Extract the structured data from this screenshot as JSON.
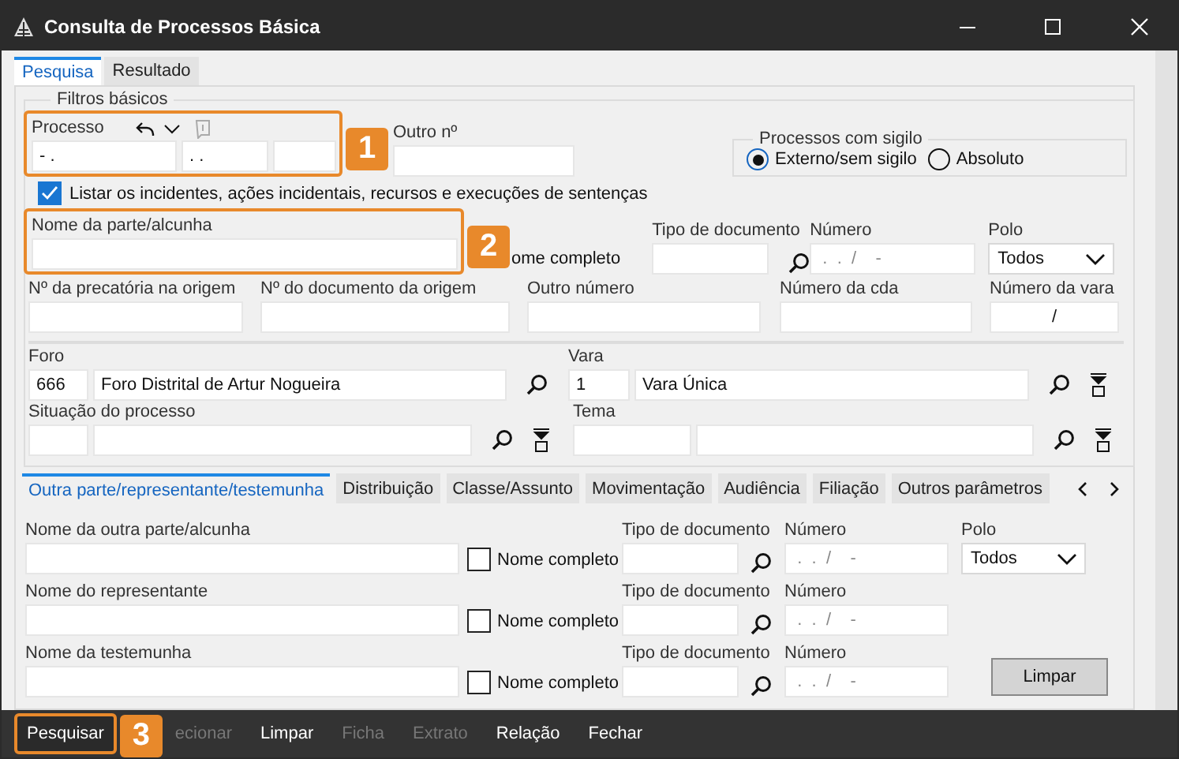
{
  "window": {
    "title": "Consulta de Processos Básica"
  },
  "tabs": [
    {
      "label": "Pesquisa",
      "selected": true
    },
    {
      "label": "Resultado",
      "selected": false
    }
  ],
  "filtros": {
    "legend": "Filtros básicos",
    "processo": {
      "label": "Processo",
      "values": [
        "- .",
        ". ."
      ]
    },
    "outro_no": {
      "label": "Outro nº"
    },
    "sigilo": {
      "legend": "Processos com sigilo",
      "options": [
        {
          "label": "Externo/sem sigilo",
          "selected": true
        },
        {
          "label": "Absoluto",
          "selected": false
        }
      ]
    },
    "listar": {
      "label": "Listar os incidentes, ações incidentais, recursos e execuções de sentenças",
      "checked": true
    },
    "nome_parte": {
      "label": "Nome da parte/alcunha",
      "nome_completo": "ome completo"
    },
    "tipo_documento": {
      "label": "Tipo de documento"
    },
    "numero": {
      "label": "Número",
      "placeholder": " .  .  /    -"
    },
    "polo": {
      "label": "Polo",
      "value": "Todos"
    },
    "outros_numeros": [
      {
        "label": "Nº da precatória na origem"
      },
      {
        "label": "Nº do documento da origem"
      },
      {
        "label": "Outro número"
      },
      {
        "label": "Número da cda"
      },
      {
        "label": "Número da vara",
        "value": "/"
      }
    ],
    "foro": {
      "label": "Foro",
      "code": "666",
      "name": "Foro Distrital de Artur Nogueira"
    },
    "vara": {
      "label": "Vara",
      "code": "1",
      "name": "Vara Única"
    },
    "situacao": {
      "label": "Situação do processo"
    },
    "tema": {
      "label": "Tema"
    }
  },
  "subtabs": [
    {
      "label": "Outra parte/representante/testemunha",
      "selected": true
    },
    {
      "label": "Distribuição",
      "selected": false
    },
    {
      "label": "Classe/Assunto",
      "selected": false
    },
    {
      "label": "Movimentação",
      "selected": false
    },
    {
      "label": "Audiência",
      "selected": false
    },
    {
      "label": "Filiação",
      "selected": false
    },
    {
      "label": "Outros parâmetros",
      "selected": false
    }
  ],
  "pessoas": [
    {
      "label": "Nome da outra parte/alcunha",
      "checkbox": "Nome completo",
      "checked": false,
      "doc_label": "Tipo de documento",
      "numero_label": "Número",
      "numero_placeholder": " .  .  /    -",
      "polo": {
        "label": "Polo",
        "value": "Todos"
      }
    },
    {
      "label": "Nome do representante",
      "checkbox": "Nome completo",
      "checked": false,
      "doc_label": "Tipo de documento",
      "numero_label": "Número",
      "numero_placeholder": " .  .  /    -"
    },
    {
      "label": "Nome da testemunha",
      "checkbox": "Nome completo",
      "checked": false,
      "doc_label": "Tipo de documento",
      "numero_label": "Número",
      "numero_placeholder": " .  .  /    -"
    }
  ],
  "limpar_button": "Limpar",
  "toolbar": [
    {
      "label": "Pesquisar",
      "disabled": false
    },
    {
      "label": "ecionar",
      "disabled": true
    },
    {
      "label": "Limpar",
      "disabled": false
    },
    {
      "label": "Ficha",
      "disabled": true
    },
    {
      "label": "Extrato",
      "disabled": true
    },
    {
      "label": "Relação",
      "disabled": false
    },
    {
      "label": "Fechar",
      "disabled": false
    }
  ],
  "annotations": [
    {
      "number": "1"
    },
    {
      "number": "2"
    },
    {
      "number": "3"
    }
  ]
}
